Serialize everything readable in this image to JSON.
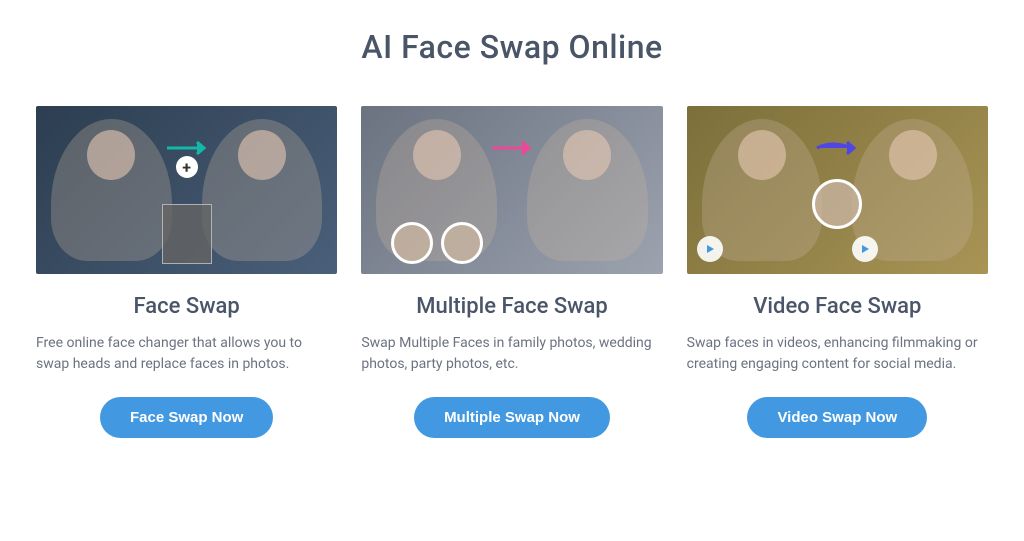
{
  "page": {
    "title": "AI Face Swap Online"
  },
  "cards": [
    {
      "title": "Face Swap",
      "description": "Free online face changer that allows you to swap heads and replace faces in photos.",
      "button_label": "Face Swap Now"
    },
    {
      "title": "Multiple Face Swap",
      "description": "Swap Multiple Faces in family photos, wedding photos, party photos, etc.",
      "button_label": "Multiple Swap Now"
    },
    {
      "title": "Video Face Swap",
      "description": "Swap faces in videos, enhancing filmmaking or creating engaging content for social media.",
      "button_label": "Video Swap Now"
    }
  ]
}
